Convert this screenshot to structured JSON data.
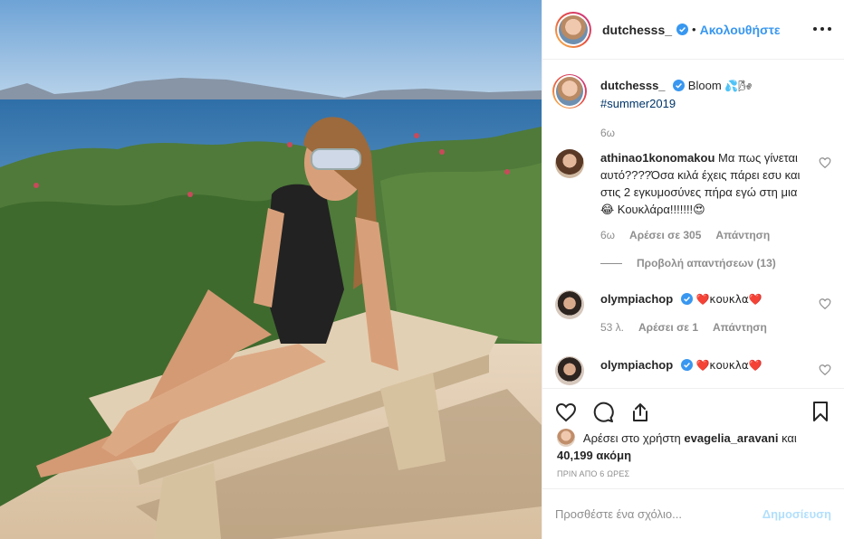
{
  "post": {
    "username": "dutchesss_",
    "follow_separator": "•",
    "follow_label": "Ακολουθήστε"
  },
  "caption": {
    "username": "dutchesss_",
    "text": "Bloom",
    "emoji": "💦🌬",
    "hashtag": "#summer2019",
    "age": "6ω"
  },
  "comments": [
    {
      "username": "athinao1konomakou",
      "text": "Μα πως γίνεται αυτό????Όσα κιλά έχεις πάρει εσυ και στις 2 εγκυμοσύνες πήρα εγώ στη μια 😂 Κουκλάρα!!!!!!!😍",
      "age": "6ω",
      "likes": "Αρέσει σε 305",
      "reply": "Απάντηση",
      "view_replies": "Προβολή απαντήσεων (13)"
    },
    {
      "username": "olympiachop",
      "text": "❤️κουκλα❤️",
      "age": "53 λ.",
      "likes": "Αρέσει σε 1",
      "reply": "Απάντηση"
    },
    {
      "username": "olympiachop",
      "text": "❤️κουκλα❤️"
    }
  ],
  "likes": {
    "prefix": "Αρέσει στο χρήστη",
    "user": "evagelia_aravani",
    "conj": "και",
    "count": "40,199 ακόμη"
  },
  "timestamp": "ΠΡΙΝ ΑΠΟ 6 ΩΡΕΣ",
  "add_comment": {
    "placeholder": "Προσθέστε ένα σχόλιο...",
    "post_label": "Δημοσίευση"
  },
  "colors": {
    "link": "#3897f0",
    "verified": "#3897f0",
    "muted": "#8e8e8e"
  }
}
